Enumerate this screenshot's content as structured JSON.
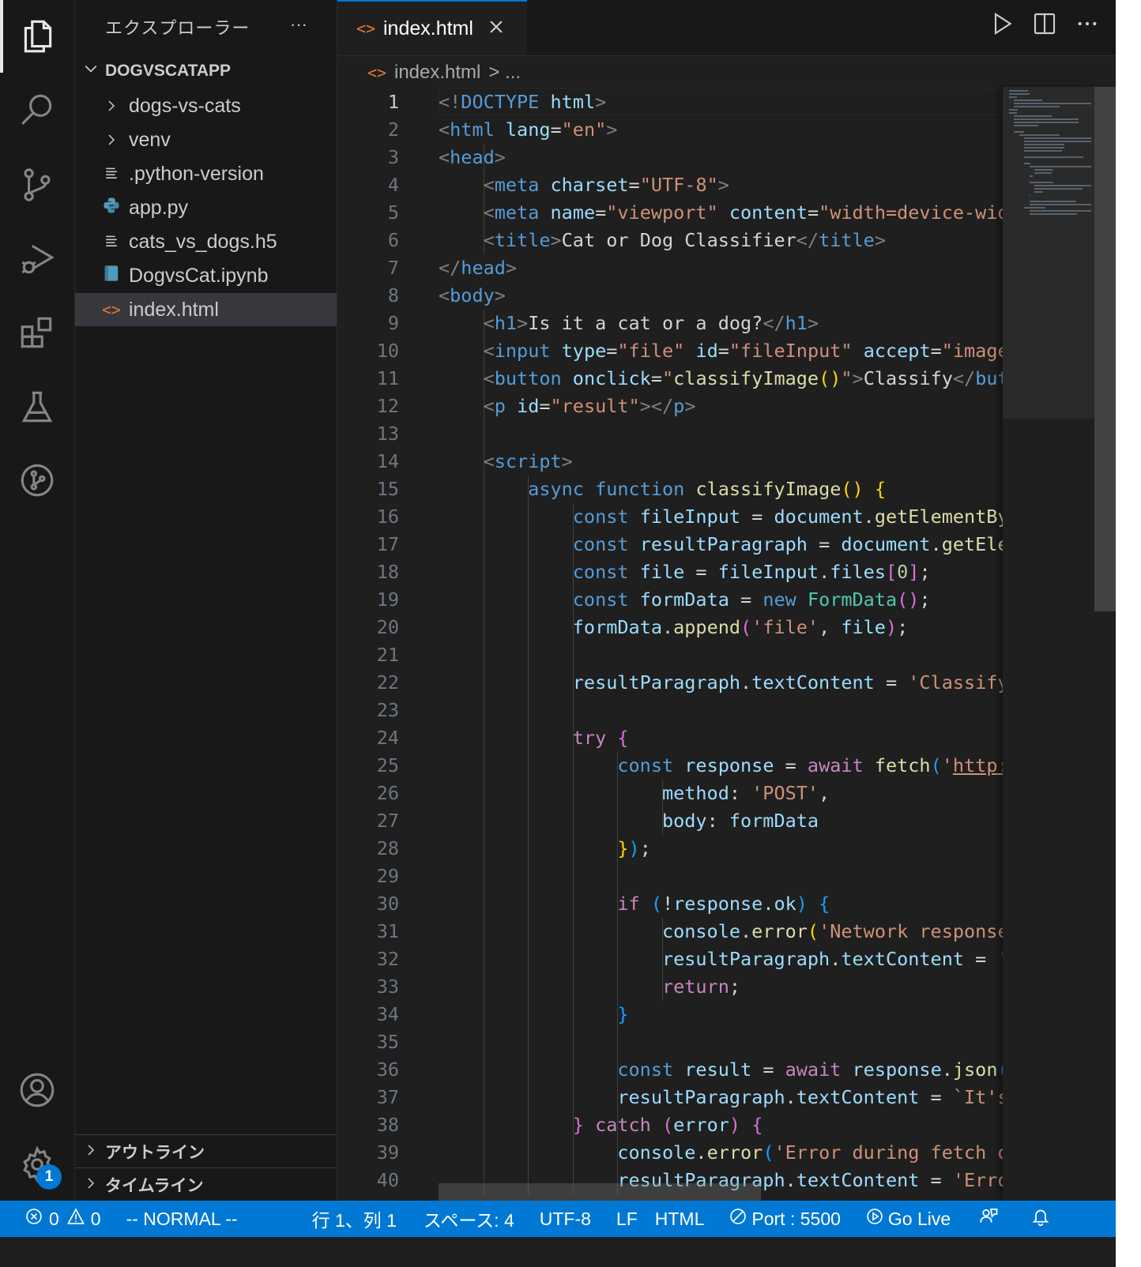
{
  "sidebar": {
    "title": "エクスプローラー",
    "more": "···",
    "root": "DOGVSCATAPP",
    "items": [
      {
        "label": "dogs-vs-cats",
        "type": "folder"
      },
      {
        "label": "venv",
        "type": "folder"
      },
      {
        "label": ".python-version",
        "type": "file"
      },
      {
        "label": "app.py",
        "type": "python"
      },
      {
        "label": "cats_vs_dogs.h5",
        "type": "file"
      },
      {
        "label": "DogvsCat.ipynb",
        "type": "notebook"
      },
      {
        "label": "index.html",
        "type": "html",
        "selected": true
      }
    ],
    "outline": "アウトライン",
    "timeline": "タイムライン"
  },
  "activity": {
    "settings_badge": "1"
  },
  "editor": {
    "tab_label": "index.html",
    "breadcrumb_file": "index.html",
    "breadcrumb_more": "> ...",
    "active_line": 1
  },
  "code_lines": [
    [
      [
        "p",
        "<!"
      ],
      [
        "t",
        "DOCTYPE"
      ],
      [
        "x",
        " "
      ],
      [
        "a",
        "html"
      ],
      [
        "p",
        ">"
      ]
    ],
    [
      [
        "p",
        "<"
      ],
      [
        "t",
        "html"
      ],
      [
        "x",
        " "
      ],
      [
        "a",
        "lang"
      ],
      [
        "x",
        "="
      ],
      [
        "s",
        "\"en\""
      ],
      [
        "p",
        ">"
      ]
    ],
    [
      [
        "p",
        "<"
      ],
      [
        "t",
        "head"
      ],
      [
        "p",
        ">"
      ]
    ],
    [
      [
        "x",
        "    "
      ],
      [
        "p",
        "<"
      ],
      [
        "t",
        "meta"
      ],
      [
        "x",
        " "
      ],
      [
        "a",
        "charset"
      ],
      [
        "x",
        "="
      ],
      [
        "s",
        "\"UTF-8\""
      ],
      [
        "p",
        ">"
      ]
    ],
    [
      [
        "x",
        "    "
      ],
      [
        "p",
        "<"
      ],
      [
        "t",
        "meta"
      ],
      [
        "x",
        " "
      ],
      [
        "a",
        "name"
      ],
      [
        "x",
        "="
      ],
      [
        "s",
        "\"viewport\""
      ],
      [
        "x",
        " "
      ],
      [
        "a",
        "content"
      ],
      [
        "x",
        "="
      ],
      [
        "s",
        "\"width=device-width, initial-scale=1.0\""
      ],
      [
        "p",
        ">"
      ]
    ],
    [
      [
        "x",
        "    "
      ],
      [
        "p",
        "<"
      ],
      [
        "t",
        "title"
      ],
      [
        "p",
        ">"
      ],
      [
        "x",
        "Cat or Dog Classifier"
      ],
      [
        "p",
        "</"
      ],
      [
        "t",
        "title"
      ],
      [
        "p",
        ">"
      ]
    ],
    [
      [
        "p",
        "</"
      ],
      [
        "t",
        "head"
      ],
      [
        "p",
        ">"
      ]
    ],
    [
      [
        "p",
        "<"
      ],
      [
        "t",
        "body"
      ],
      [
        "p",
        ">"
      ]
    ],
    [
      [
        "x",
        "    "
      ],
      [
        "p",
        "<"
      ],
      [
        "t",
        "h1"
      ],
      [
        "p",
        ">"
      ],
      [
        "x",
        "Is it a cat or a dog?"
      ],
      [
        "p",
        "</"
      ],
      [
        "t",
        "h1"
      ],
      [
        "p",
        ">"
      ]
    ],
    [
      [
        "x",
        "    "
      ],
      [
        "p",
        "<"
      ],
      [
        "t",
        "input"
      ],
      [
        "x",
        " "
      ],
      [
        "a",
        "type"
      ],
      [
        "x",
        "="
      ],
      [
        "s",
        "\"file\""
      ],
      [
        "x",
        " "
      ],
      [
        "a",
        "id"
      ],
      [
        "x",
        "="
      ],
      [
        "s",
        "\"fileInput\""
      ],
      [
        "x",
        " "
      ],
      [
        "a",
        "accept"
      ],
      [
        "x",
        "="
      ],
      [
        "s",
        "\"image/*\""
      ],
      [
        "p",
        ">"
      ]
    ],
    [
      [
        "x",
        "    "
      ],
      [
        "p",
        "<"
      ],
      [
        "t",
        "button"
      ],
      [
        "x",
        " "
      ],
      [
        "a",
        "onclick"
      ],
      [
        "x",
        "="
      ],
      [
        "s",
        "\""
      ],
      [
        "f",
        "classifyImage"
      ],
      [
        "b1",
        "()"
      ],
      [
        "s",
        "\""
      ],
      [
        "p",
        ">"
      ],
      [
        "x",
        "Classify"
      ],
      [
        "p",
        "</"
      ],
      [
        "t",
        "button"
      ],
      [
        "p",
        ">"
      ]
    ],
    [
      [
        "x",
        "    "
      ],
      [
        "p",
        "<"
      ],
      [
        "t",
        "p"
      ],
      [
        "x",
        " "
      ],
      [
        "a",
        "id"
      ],
      [
        "x",
        "="
      ],
      [
        "s",
        "\"result\""
      ],
      [
        "p",
        "></"
      ],
      [
        "t",
        "p"
      ],
      [
        "p",
        ">"
      ]
    ],
    [],
    [
      [
        "x",
        "    "
      ],
      [
        "p",
        "<"
      ],
      [
        "t",
        "script"
      ],
      [
        "p",
        ">"
      ]
    ],
    [
      [
        "x",
        "        "
      ],
      [
        "k",
        "async"
      ],
      [
        "x",
        " "
      ],
      [
        "k",
        "function"
      ],
      [
        "x",
        " "
      ],
      [
        "f",
        "classifyImage"
      ],
      [
        "b1",
        "()"
      ],
      [
        "x",
        " "
      ],
      [
        "b1",
        "{"
      ]
    ],
    [
      [
        "x",
        "            "
      ],
      [
        "k",
        "const"
      ],
      [
        "x",
        " "
      ],
      [
        "v",
        "fileInput"
      ],
      [
        "x",
        " = "
      ],
      [
        "v",
        "document"
      ],
      [
        "x",
        "."
      ],
      [
        "f",
        "getElementById"
      ],
      [
        "b2",
        "("
      ],
      [
        "s",
        "'fileInput'"
      ],
      [
        "b2",
        ")"
      ],
      [
        "x",
        ";"
      ]
    ],
    [
      [
        "x",
        "            "
      ],
      [
        "k",
        "const"
      ],
      [
        "x",
        " "
      ],
      [
        "v",
        "resultParagraph"
      ],
      [
        "x",
        " = "
      ],
      [
        "v",
        "document"
      ],
      [
        "x",
        "."
      ],
      [
        "f",
        "getElementById"
      ],
      [
        "b2",
        "("
      ],
      [
        "s",
        "'result'"
      ],
      [
        "b2",
        ")"
      ],
      [
        "x",
        ";"
      ]
    ],
    [
      [
        "x",
        "            "
      ],
      [
        "k",
        "const"
      ],
      [
        "x",
        " "
      ],
      [
        "v",
        "file"
      ],
      [
        "x",
        " = "
      ],
      [
        "v",
        "fileInput"
      ],
      [
        "x",
        "."
      ],
      [
        "v",
        "files"
      ],
      [
        "b2",
        "["
      ],
      [
        "n",
        "0"
      ],
      [
        "b2",
        "]"
      ],
      [
        "x",
        ";"
      ]
    ],
    [
      [
        "x",
        "            "
      ],
      [
        "k",
        "const"
      ],
      [
        "x",
        " "
      ],
      [
        "v",
        "formData"
      ],
      [
        "x",
        " = "
      ],
      [
        "k",
        "new"
      ],
      [
        "x",
        " "
      ],
      [
        "cl",
        "FormData"
      ],
      [
        "b2",
        "()"
      ],
      [
        "x",
        ";"
      ]
    ],
    [
      [
        "x",
        "            "
      ],
      [
        "v",
        "formData"
      ],
      [
        "x",
        "."
      ],
      [
        "f",
        "append"
      ],
      [
        "b2",
        "("
      ],
      [
        "s",
        "'file'"
      ],
      [
        "x",
        ", "
      ],
      [
        "v",
        "file"
      ],
      [
        "b2",
        ")"
      ],
      [
        "x",
        ";"
      ]
    ],
    [],
    [
      [
        "x",
        "            "
      ],
      [
        "v",
        "resultParagraph"
      ],
      [
        "x",
        "."
      ],
      [
        "v",
        "textContent"
      ],
      [
        "x",
        " = "
      ],
      [
        "s",
        "'Classifying...'"
      ],
      [
        "x",
        ";"
      ]
    ],
    [],
    [
      [
        "x",
        "            "
      ],
      [
        "c",
        "try"
      ],
      [
        "x",
        " "
      ],
      [
        "b2",
        "{"
      ]
    ],
    [
      [
        "x",
        "                "
      ],
      [
        "k",
        "const"
      ],
      [
        "x",
        " "
      ],
      [
        "v",
        "response"
      ],
      [
        "x",
        " = "
      ],
      [
        "c",
        "await"
      ],
      [
        "x",
        " "
      ],
      [
        "f",
        "fetch"
      ],
      [
        "b3",
        "("
      ],
      [
        "s",
        "'"
      ],
      [
        "u",
        "http://localhost:5000/predict"
      ],
      [
        "s",
        "'"
      ],
      [
        "x",
        ", "
      ],
      [
        "b1",
        "{"
      ]
    ],
    [
      [
        "x",
        "                    "
      ],
      [
        "v",
        "method"
      ],
      [
        "x",
        ": "
      ],
      [
        "s",
        "'POST'"
      ],
      [
        "x",
        ","
      ]
    ],
    [
      [
        "x",
        "                    "
      ],
      [
        "v",
        "body"
      ],
      [
        "x",
        ": "
      ],
      [
        "v",
        "formData"
      ]
    ],
    [
      [
        "x",
        "                "
      ],
      [
        "b1",
        "}"
      ],
      [
        "b3",
        ")"
      ],
      [
        "x",
        ";"
      ]
    ],
    [],
    [
      [
        "x",
        "                "
      ],
      [
        "c",
        "if"
      ],
      [
        "x",
        " "
      ],
      [
        "b3",
        "("
      ],
      [
        "x",
        "!"
      ],
      [
        "v",
        "response"
      ],
      [
        "x",
        "."
      ],
      [
        "v",
        "ok"
      ],
      [
        "b3",
        ")"
      ],
      [
        "x",
        " "
      ],
      [
        "b3",
        "{"
      ]
    ],
    [
      [
        "x",
        "                    "
      ],
      [
        "v",
        "console"
      ],
      [
        "x",
        "."
      ],
      [
        "f",
        "error"
      ],
      [
        "b1",
        "("
      ],
      [
        "s",
        "'Network response was not ok'"
      ],
      [
        "b1",
        ")"
      ],
      [
        "x",
        ";"
      ]
    ],
    [
      [
        "x",
        "                    "
      ],
      [
        "v",
        "resultParagraph"
      ],
      [
        "x",
        "."
      ],
      [
        "v",
        "textContent"
      ],
      [
        "x",
        " = "
      ],
      [
        "s",
        "'Error'"
      ],
      [
        "x",
        ";"
      ]
    ],
    [
      [
        "x",
        "                    "
      ],
      [
        "c",
        "return"
      ],
      [
        "x",
        ";"
      ]
    ],
    [
      [
        "x",
        "                "
      ],
      [
        "b3",
        "}"
      ]
    ],
    [],
    [
      [
        "x",
        "                "
      ],
      [
        "k",
        "const"
      ],
      [
        "x",
        " "
      ],
      [
        "v",
        "result"
      ],
      [
        "x",
        " = "
      ],
      [
        "c",
        "await"
      ],
      [
        "x",
        " "
      ],
      [
        "v",
        "response"
      ],
      [
        "x",
        "."
      ],
      [
        "f",
        "json"
      ],
      [
        "b3",
        "()"
      ],
      [
        "x",
        ";"
      ]
    ],
    [
      [
        "x",
        "                "
      ],
      [
        "v",
        "resultParagraph"
      ],
      [
        "x",
        "."
      ],
      [
        "v",
        "textContent"
      ],
      [
        "x",
        " = "
      ],
      [
        "s",
        "`It's a ${result}`"
      ],
      [
        "x",
        ";"
      ]
    ],
    [
      [
        "x",
        "            "
      ],
      [
        "b2",
        "}"
      ],
      [
        "x",
        " "
      ],
      [
        "c",
        "catch"
      ],
      [
        "x",
        " "
      ],
      [
        "b2",
        "("
      ],
      [
        "v",
        "error"
      ],
      [
        "b2",
        ")"
      ],
      [
        "x",
        " "
      ],
      [
        "b2",
        "{"
      ]
    ],
    [
      [
        "x",
        "                "
      ],
      [
        "v",
        "console"
      ],
      [
        "x",
        "."
      ],
      [
        "f",
        "error"
      ],
      [
        "b3",
        "("
      ],
      [
        "s",
        "'Error during fetch operation:'"
      ],
      [
        "x",
        ", "
      ],
      [
        "v",
        "error"
      ],
      [
        "b3",
        ")"
      ],
      [
        "x",
        ";"
      ]
    ],
    [
      [
        "x",
        "                "
      ],
      [
        "v",
        "resultParagraph"
      ],
      [
        "x",
        "."
      ],
      [
        "v",
        "textContent"
      ],
      [
        "x",
        " = "
      ],
      [
        "s",
        "'Error'"
      ],
      [
        "x",
        ";"
      ]
    ]
  ],
  "status": {
    "errors": "0",
    "warnings": "0",
    "mode": "-- NORMAL --",
    "position": "行 1、列 1",
    "indent": "スペース: 4",
    "encoding": "UTF-8",
    "eol": "LF",
    "language": "HTML",
    "port": "Port : 5500",
    "golive": "Go Live"
  },
  "colors": {
    "accent": "#0078d4",
    "editor_bg": "#1f1f1f",
    "sidebar_bg": "#181818"
  }
}
